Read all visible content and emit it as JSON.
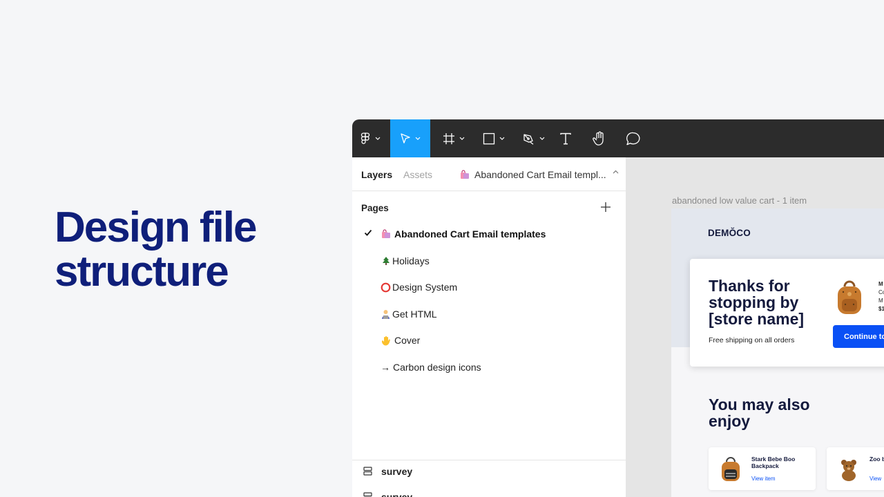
{
  "hero": {
    "line1": "Design file",
    "line2": "structure"
  },
  "colors": {
    "hero_text": "#0f1f7a",
    "toolbar_bg": "#2c2c2c",
    "tool_active": "#18a0fb",
    "cta_blue": "#0a50f5",
    "brand_navy": "#141a3d"
  },
  "toolbar": {
    "tools": [
      {
        "icon": "figma-menu-icon"
      },
      {
        "icon": "move-tool-icon",
        "active": true
      },
      {
        "icon": "frame-tool-icon"
      },
      {
        "icon": "rectangle-tool-icon"
      },
      {
        "icon": "pen-tool-icon"
      },
      {
        "icon": "text-tool-icon"
      },
      {
        "icon": "hand-tool-icon"
      },
      {
        "icon": "comment-tool-icon"
      }
    ]
  },
  "panel": {
    "tabs": {
      "layers": "Layers",
      "assets": "Assets"
    },
    "current_page": {
      "emoji": "shopping-bags-icon",
      "label": "Abandoned Cart Email templ..."
    },
    "pages_header": "Pages",
    "pages": [
      {
        "label": "Abandoned Cart Email templates",
        "emoji": "shopping-bags-icon",
        "selected": true
      },
      {
        "label": "Holidays",
        "emoji": "christmas-tree-icon"
      },
      {
        "label": "Design System",
        "emoji": "red-circle-icon"
      },
      {
        "label": "Get HTML",
        "emoji": "technologist-icon"
      },
      {
        "label": "Cover",
        "emoji": "waving-hand-icon"
      },
      {
        "label": "Carbon design icons",
        "emoji": "arrow-icon",
        "prefix": "→"
      }
    ],
    "layers": [
      {
        "label": "survey"
      },
      {
        "label": "survey"
      }
    ]
  },
  "canvas": {
    "frame_label": "abandoned low value cart - 1 item",
    "brand": "DEMŎCO",
    "headline": "Thanks for stopping by [store name]",
    "shipping": "Free shipping on all orders",
    "mini_product": {
      "title": "M",
      "line1": "Co",
      "line2": "M",
      "price": "$1"
    },
    "cta": "Continue to",
    "enjoy": "You may also enjoy",
    "recommendations": [
      {
        "title": "Stark Bebe Boo Backpack",
        "link": "View item"
      },
      {
        "title": "Zoo back",
        "link": "View"
      }
    ]
  }
}
